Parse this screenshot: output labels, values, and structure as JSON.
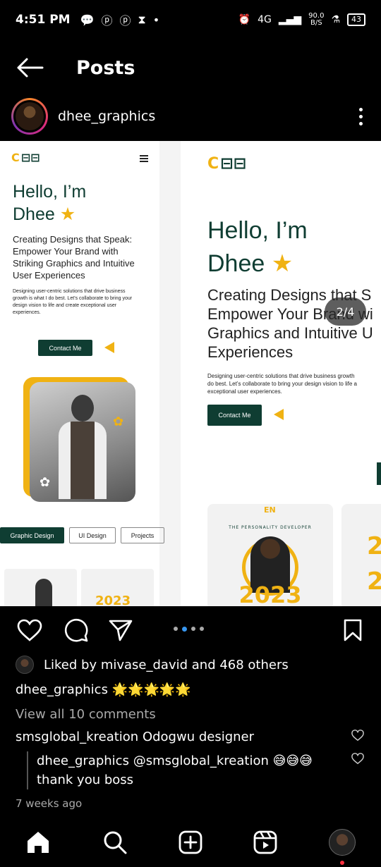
{
  "status_bar": {
    "time": "4:51 PM",
    "network": "4G",
    "speed": "90.0",
    "speed_unit": "B/S",
    "battery": "43"
  },
  "header": {
    "title": "Posts"
  },
  "account": {
    "username": "dhee_graphics"
  },
  "post": {
    "counter": "2/4",
    "mobile": {
      "hello": "Hello, I’m",
      "name": "Dhee",
      "subheading": "Creating Designs that Speak: Empower Your Brand with Striking Graphics and Intuitive User Experiences",
      "body": "Designing user-centric solutions that drive business growth is what I do best. Let’s collaborate to bring your design vision to life and create exceptional user experiences.",
      "contact_label": "Contact Me",
      "tabs": [
        "Graphic Design",
        "UI Design",
        "Projects"
      ],
      "card_year": "2023"
    },
    "desktop": {
      "hello": "Hello, I’m",
      "name": "Dhee",
      "sub_line1": "Creating Designs that S",
      "sub_line2": "Empower Your Brand wi",
      "sub_line3": "Graphics and Intuitive U",
      "sub_line4": "Experiences",
      "body_line1": "Designing user-centric solutions that drive business growth",
      "body_line2": "do best. Let’s collaborate to bring your design vision to life a",
      "body_line3": "exceptional user experiences.",
      "contact_label": "Contact Me",
      "card_heading": "THE PERSONALITY DEVELOPER",
      "card_year": "2023"
    }
  },
  "likes": {
    "text": "Liked by mivase_david and 468 others"
  },
  "caption": {
    "username": "dhee_graphics",
    "text": "🌟🌟🌟🌟🌟"
  },
  "comments": {
    "view_all": "View all 10 comments",
    "items": [
      {
        "username": "smsglobal_kreation",
        "text": "Odogwu designer"
      }
    ],
    "reply": {
      "username": "dhee_graphics",
      "text_line1": "@smsglobal_kreation 😅😅😅",
      "text_line2": "thank you boss"
    }
  },
  "time_ago": "7 weeks ago",
  "colors": {
    "accent_blue": "#3897f0",
    "brand_green": "#0f3d32",
    "brand_yellow": "#f0b213"
  }
}
